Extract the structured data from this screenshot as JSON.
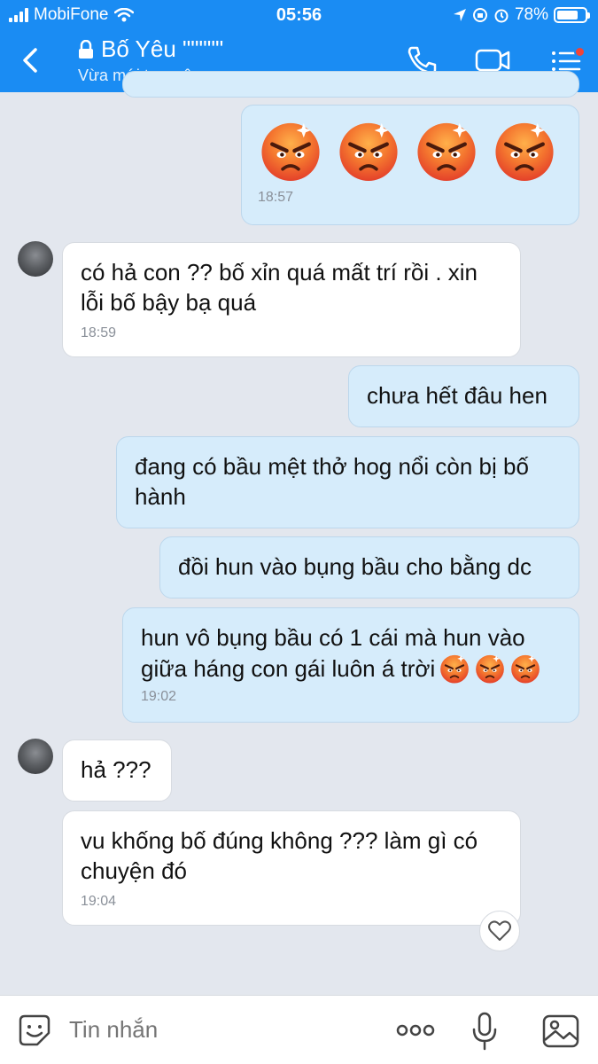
{
  "status_bar": {
    "carrier": "MobiFone",
    "time": "05:56",
    "battery": "78%",
    "battery_level": 0.78
  },
  "header": {
    "title": "Bố Yêu \"\"\"\"\"",
    "subtitle": "Vừa mới truy cập"
  },
  "messages": [
    {
      "dir": "out",
      "emoji_count": 4,
      "time": "18:57"
    },
    {
      "dir": "in",
      "text_lines": [
        "có hả con ?? bố xỉn quá mất trí rồi . xin",
        "lỗi bố bậy bạ quá"
      ],
      "time": "18:59"
    },
    {
      "dir": "out",
      "text_lines": [
        "chưa hết đâu hen"
      ]
    },
    {
      "dir": "out",
      "text_lines": [
        "đang có bầu mệt thở hog nổi còn bị bố",
        "hành"
      ]
    },
    {
      "dir": "out",
      "text_lines": [
        "đồi hun vào bụng bầu cho bằng dc"
      ]
    },
    {
      "dir": "out",
      "text_lines": [
        "hun vô bụng bầu có 1 cái mà hun vào",
        "giữa háng con gái luôn á trời"
      ],
      "emoji_count": 3,
      "time": "19:02"
    },
    {
      "dir": "in",
      "text_lines": [
        "hả ???"
      ]
    },
    {
      "dir": "in",
      "text_lines": [
        "vu khống bố đúng không ??? làm gì có",
        "chuyện đó"
      ],
      "time": "19:04"
    }
  ],
  "composer": {
    "placeholder": "Tin nhắn"
  },
  "icons": {
    "emoji": "angry-face-icon",
    "back": "chevron-left-icon",
    "lock": "lock-icon",
    "call": "phone-icon",
    "video": "video-camera-icon",
    "menu": "menu-list-icon",
    "sticker": "sticker-smile-icon",
    "more": "more-dots-icon",
    "mic": "microphone-icon",
    "image": "image-icon",
    "reaction": "heart-icon"
  },
  "colors": {
    "header": "#1a8cf3",
    "outgoing_bubble": "#d6ecfb",
    "incoming_bubble": "#ffffff",
    "background": "#e3e7ee",
    "badge": "#f04438"
  }
}
